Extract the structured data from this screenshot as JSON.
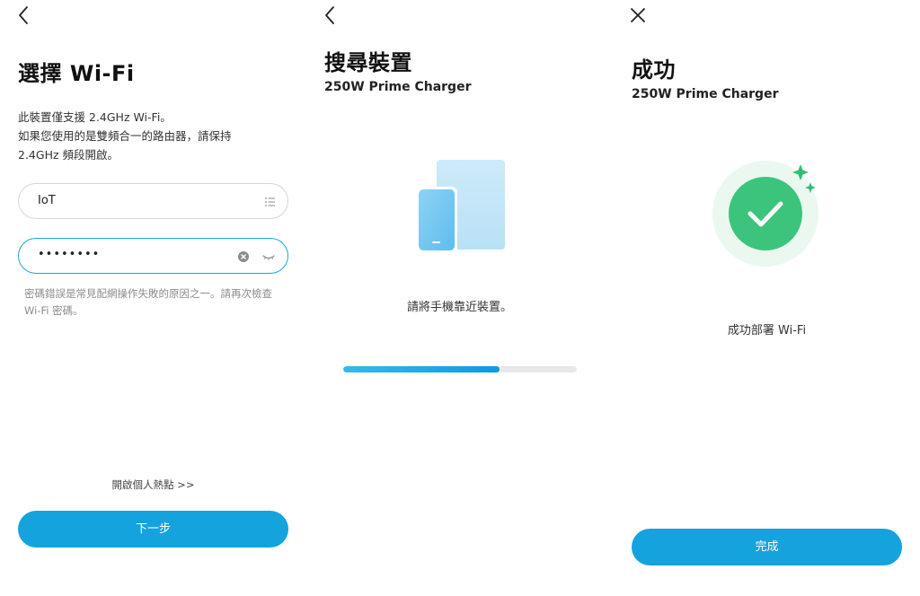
{
  "screen1": {
    "back_icon": "chevron-left-icon",
    "title": "選擇 Wi-Fi",
    "description_lines": [
      "此裝置僅支援 2.4GHz Wi-Fi。",
      "如果您使用的是雙頻合一的路由器，請保持",
      "2.4GHz 頻段開啟。"
    ],
    "ssid_value": "IoT",
    "ssid_list_icon": "list-icon",
    "password_value": "••••••••",
    "clear_icon": "clear-circle-icon",
    "visibility_icon": "eye-closed-icon",
    "password_hint": "密碼錯誤是常見配網操作失敗的原因之一。請再次檢查 Wi-Fi 密碼。",
    "hotspot_link": "開啟個人熱點 >>",
    "next_button": "下一步",
    "accent_color": "#14a3dd"
  },
  "screen2": {
    "back_icon": "chevron-left-icon",
    "title": "搜尋裝置",
    "subtitle": "250W Prime Charger",
    "illustration": "phone-and-tablet-icon",
    "instruction": "請將手機靠近裝置。",
    "progress": 0.67
  },
  "screen3": {
    "close_icon": "close-icon",
    "title": "成功",
    "subtitle": "250W Prime Charger",
    "success_icon": "check-circle-sparkle-icon",
    "status_text": "成功部署 Wi-Fi",
    "done_button": "完成",
    "success_color": "#34c77b"
  }
}
